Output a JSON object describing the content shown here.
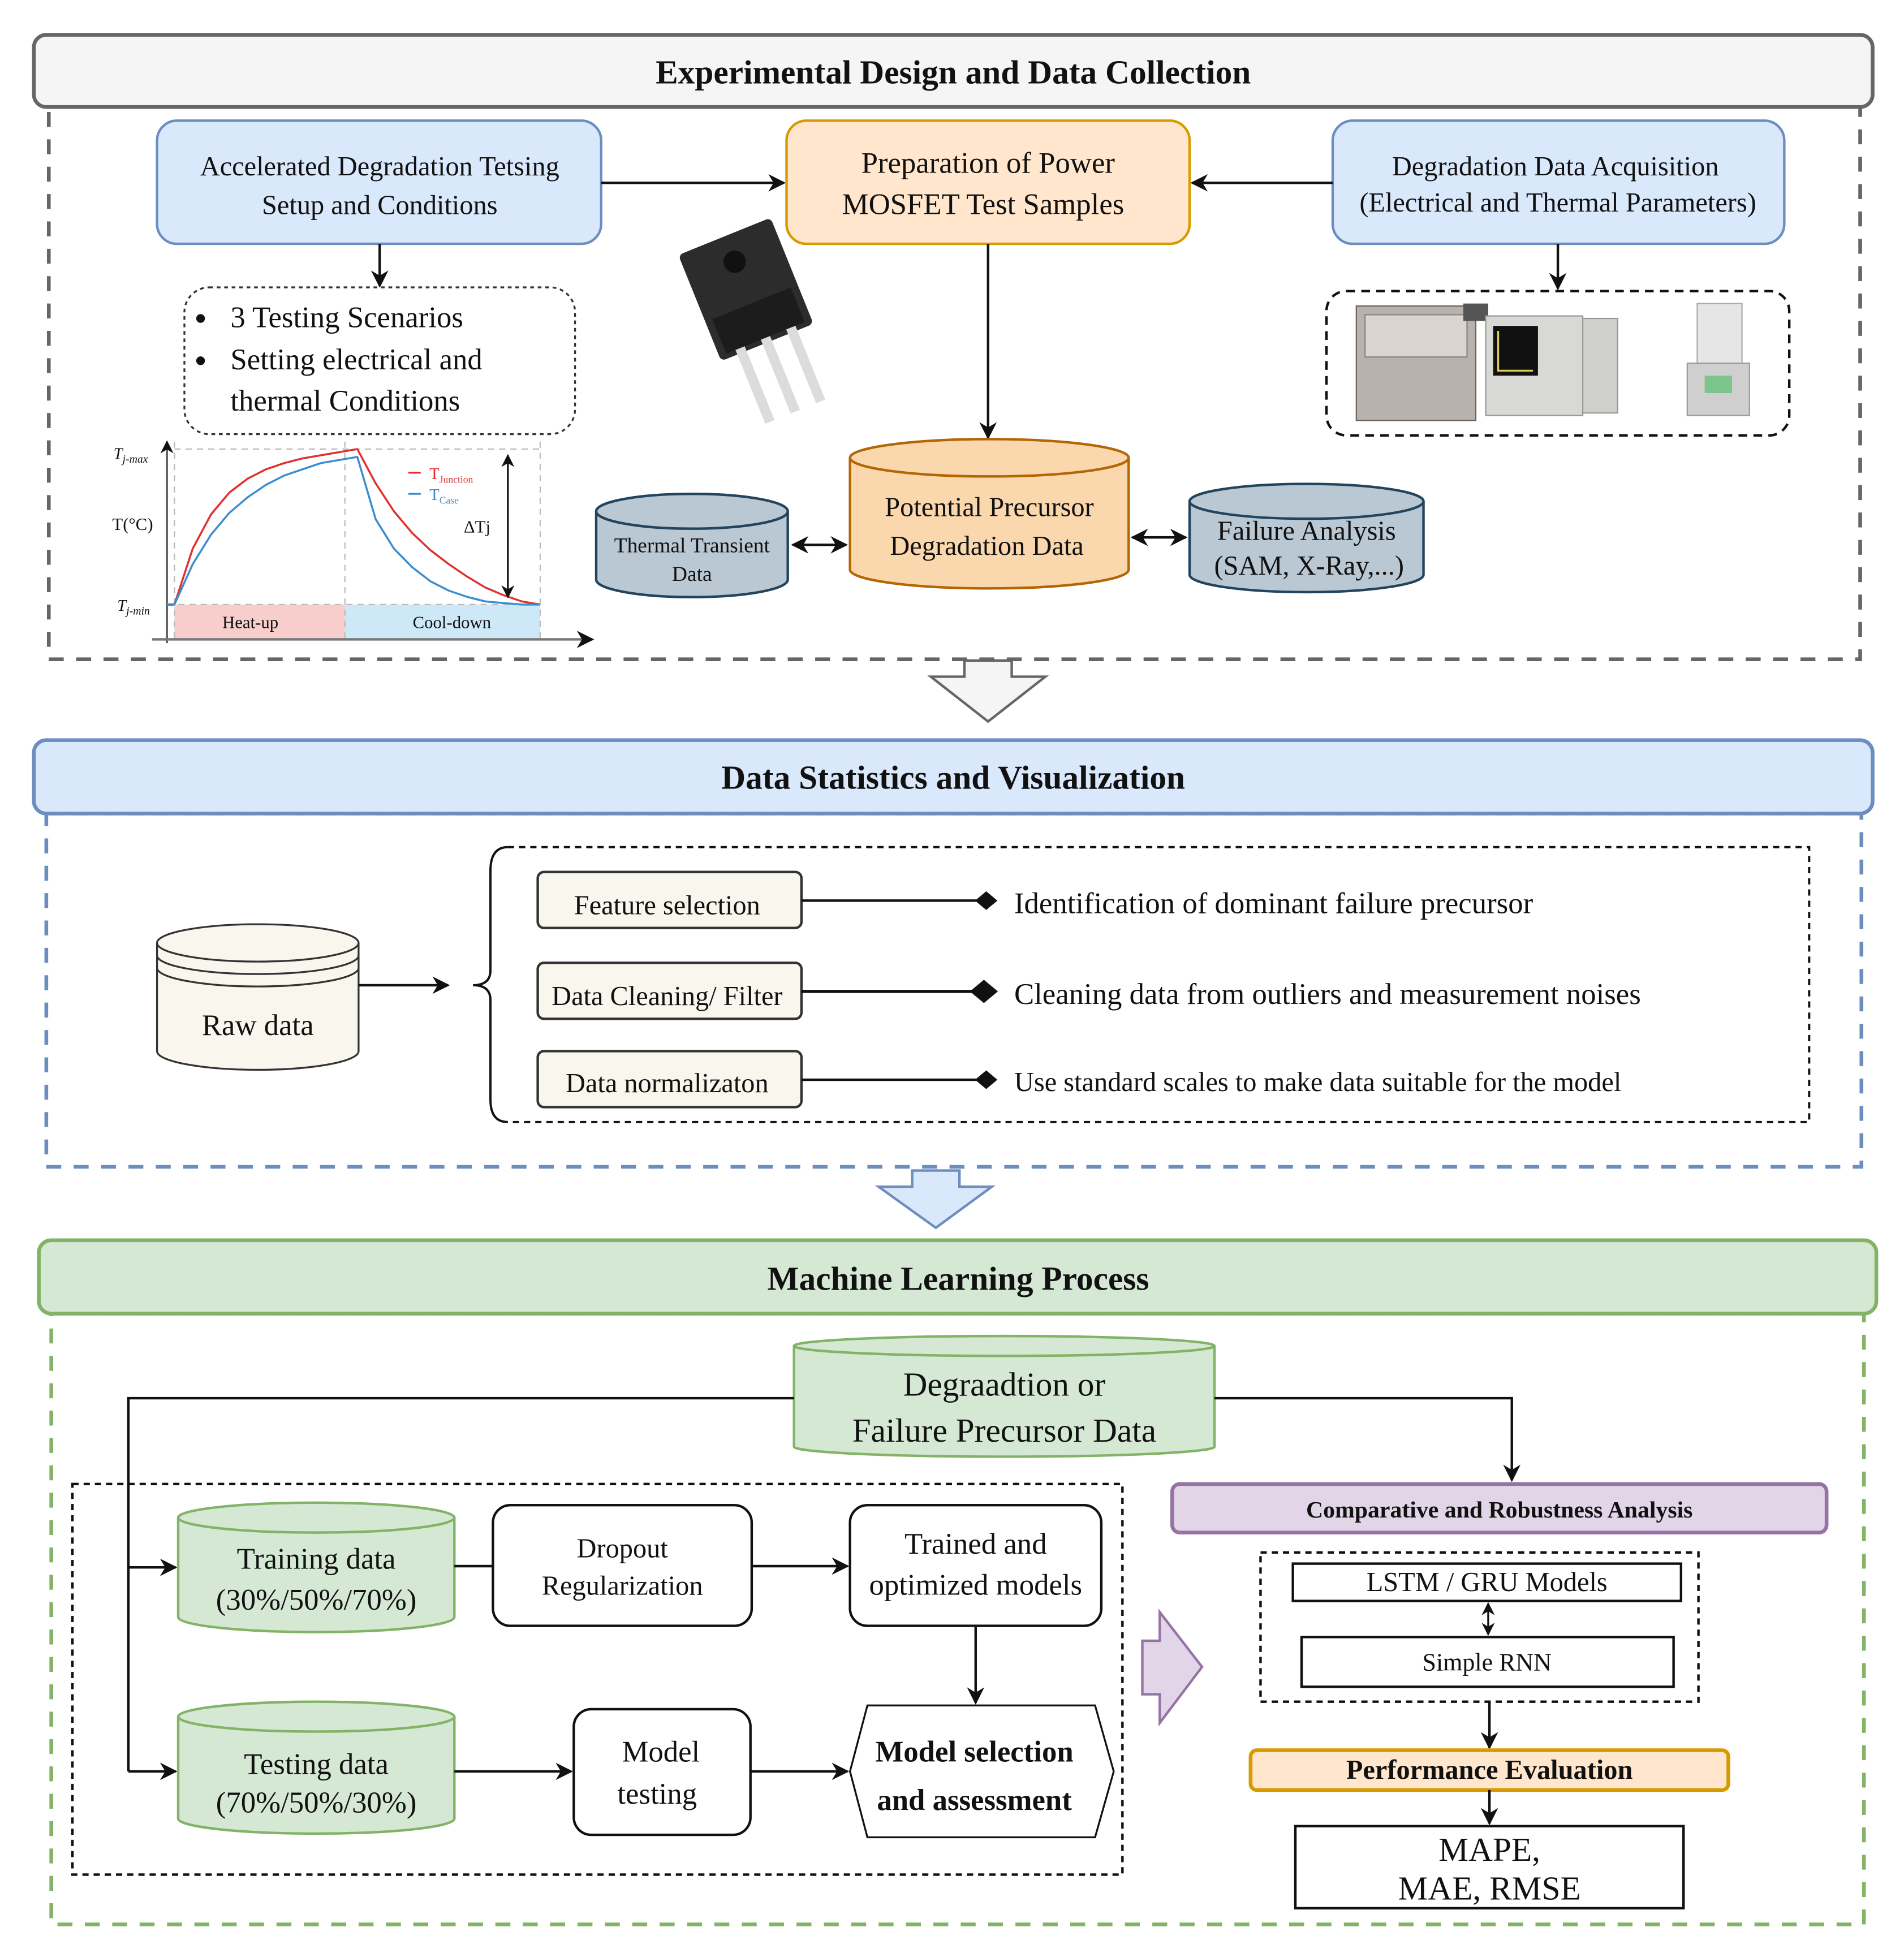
{
  "sections": {
    "experimental": {
      "title": "Experimental Design and Data Collection",
      "setup_box": [
        "Accelerated Degradation Tetsing",
        "Setup and Conditions"
      ],
      "prep_box": [
        "Preparation of Power",
        "MOSFET Test Samples"
      ],
      "acq_box": [
        "Degradation Data Acquisition",
        "(Electrical and Thermal Parameters)"
      ],
      "scenario_bullets": [
        "3 Testing Scenarios",
        "Setting electrical and",
        "thermal Conditions"
      ],
      "precursor_db": [
        "Potential Precursor",
        "Degradation Data"
      ],
      "thermal_db": [
        "Thermal Transient",
        "Data"
      ],
      "failure_db": [
        "Failure Analysis",
        "(SAM, X-Ray,...)"
      ],
      "mosfet_image": "mosfet-to247-icon",
      "equipment_image": "test-equipment-icon",
      "colors": {
        "blue_box": "#dae8fc",
        "blue_border": "#6c8ebf",
        "orange_box": "#ffe6cc",
        "orange_border": "#d79b00",
        "gray_db": "#bac8d3",
        "gray_db_border": "#23445d",
        "orange_db": "#fad7ac",
        "orange_db_border": "#b46504"
      }
    },
    "statistics": {
      "title": "Data Statistics and Visualization",
      "raw_db": "Raw data",
      "steps": [
        {
          "label": "Feature selection",
          "description": "Identification of dominant failure precursor"
        },
        {
          "label": "Data Cleaning/ Filter",
          "description": "Cleaning data from outliers and measurement noises"
        },
        {
          "label": "Data normalizaton",
          "description": "Use standard scales to make data suitable for the model"
        }
      ],
      "colors": {
        "header": "#dae8fc",
        "border": "#6c8ebf",
        "step_fill": "#f9f7ed"
      }
    },
    "ml": {
      "title": "Machine Learning Process",
      "source_db": [
        "Degraadtion or",
        "Failure Precursor Data"
      ],
      "training_db": [
        "Training data",
        "(30%/50%/70%)"
      ],
      "testing_db": [
        "Testing data",
        "(70%/50%/30%)"
      ],
      "dropout_box": [
        "Dropout",
        "Regularization"
      ],
      "trained_box": [
        "Trained and",
        "optimized models"
      ],
      "model_testing_box": [
        "Model",
        "testing"
      ],
      "selection_box": [
        "Model selection",
        "and assessment"
      ],
      "comparative_title": "Comparative and Robustness Analysis",
      "lstm_box": "LSTM / GRU Models",
      "rnn_box": "Simple RNN",
      "performance_title": "Performance Evaluation",
      "metrics_box": [
        "MAPE,",
        "MAE, RMSE"
      ],
      "colors": {
        "header": "#d5e8d4",
        "border": "#82b366",
        "purple": "#e1d5e7",
        "purple_border": "#9673a6",
        "orange": "#ffe6cc",
        "orange_border": "#d79b00"
      }
    }
  },
  "chart_data": {
    "type": "line",
    "title": "",
    "xlabel": "",
    "ylabel": "T(°C)",
    "y_ticks": [
      "T_j-max",
      "T_j-min"
    ],
    "phases": [
      "Heat-up",
      "Cool-down"
    ],
    "annotation": "ΔTj",
    "series": [
      {
        "name": "T_Junction",
        "legend_main": "T",
        "legend_sub": "Junction",
        "color": "#e0312f",
        "x": [
          0,
          0.1,
          0.2,
          0.3,
          0.4,
          0.5,
          0.6,
          0.7,
          0.8,
          0.9,
          1.0,
          1.1,
          1.2,
          1.3,
          1.4,
          1.5,
          1.6,
          1.7,
          1.8,
          1.9,
          2.0
        ],
        "y": [
          0,
          0.36,
          0.58,
          0.72,
          0.81,
          0.87,
          0.91,
          0.94,
          0.96,
          0.98,
          1.0,
          0.78,
          0.6,
          0.46,
          0.35,
          0.26,
          0.18,
          0.11,
          0.06,
          0.02,
          0.0
        ]
      },
      {
        "name": "T_Case",
        "legend_main": "T",
        "legend_sub": "Case",
        "color": "#3c8dd0",
        "x": [
          0,
          0.1,
          0.2,
          0.3,
          0.4,
          0.5,
          0.6,
          0.7,
          0.8,
          0.9,
          1.0,
          1.1,
          1.2,
          1.3,
          1.4,
          1.5,
          1.6,
          1.7,
          1.8,
          1.9,
          2.0
        ],
        "y": [
          0,
          0.26,
          0.45,
          0.59,
          0.69,
          0.77,
          0.83,
          0.87,
          0.91,
          0.93,
          0.95,
          0.55,
          0.36,
          0.24,
          0.15,
          0.09,
          0.05,
          0.02,
          0.01,
          0.0,
          0.0
        ]
      }
    ],
    "xlim": [
      0,
      2.0
    ],
    "ylim": [
      0,
      1.0
    ],
    "grid": false,
    "legend": "top-right"
  }
}
